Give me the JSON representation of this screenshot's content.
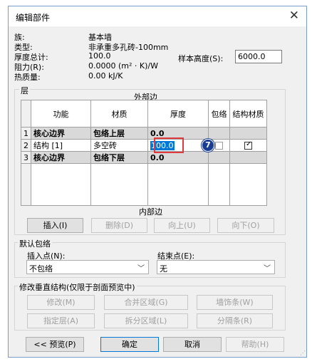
{
  "dialog": {
    "title": "编辑部件",
    "close_glyph": "✕"
  },
  "info": {
    "family_label": "族:",
    "family_value": "基本墙",
    "type_label": "类型:",
    "type_value": "非承重多孔砖-100mm",
    "thickness_label": "厚度总计:",
    "thickness_value": "100.0",
    "resistance_label": "阻力(R):",
    "resistance_value": "0.0000 (m² · K)/W",
    "thermal_label": "热质量:",
    "thermal_value": "0.00 kJ/K",
    "sample_height_label": "样本高度(S):",
    "sample_height_value": "6000.0"
  },
  "layers": {
    "group_label": "层",
    "exterior_label": "外部边",
    "interior_label": "内部边",
    "columns": [
      "功能",
      "材质",
      "厚度",
      "包络",
      "结构材质"
    ],
    "rows": [
      {
        "num": "1",
        "function": "核心边界",
        "material": "包络上层",
        "thickness": "0.0",
        "wrap": "",
        "structural": ""
      },
      {
        "num": "2",
        "function": "结构 [1]",
        "material": "多空砖",
        "thickness": "100.0",
        "wrap": false,
        "structural": true
      },
      {
        "num": "3",
        "function": "核心边界",
        "material": "包络下层",
        "thickness": "0.0",
        "wrap": "",
        "structural": ""
      }
    ],
    "callout_number": "7",
    "buttons": {
      "insert": "插入(I)",
      "delete": "删除(D)",
      "up": "向上(U)",
      "down": "向下(O)"
    }
  },
  "wrapping": {
    "group_label": "默认包络",
    "insert_point_label": "插入点(N):",
    "insert_point_value": "不包络",
    "end_point_label": "结束点(E):",
    "end_point_value": "无"
  },
  "vertical": {
    "group_label": "修改垂直结构(仅限于剖面预览中)",
    "buttons": {
      "modify": "修改(M)",
      "merge": "合并区域(G)",
      "sweeps": "墙饰条(W)",
      "assign": "指定层(A)",
      "split": "拆分区域(L)",
      "reveals": "分隔条(R)"
    }
  },
  "footer": {
    "preview": "<< 预览(P)",
    "ok": "确定",
    "cancel": "取消",
    "help": "帮助(H)"
  }
}
